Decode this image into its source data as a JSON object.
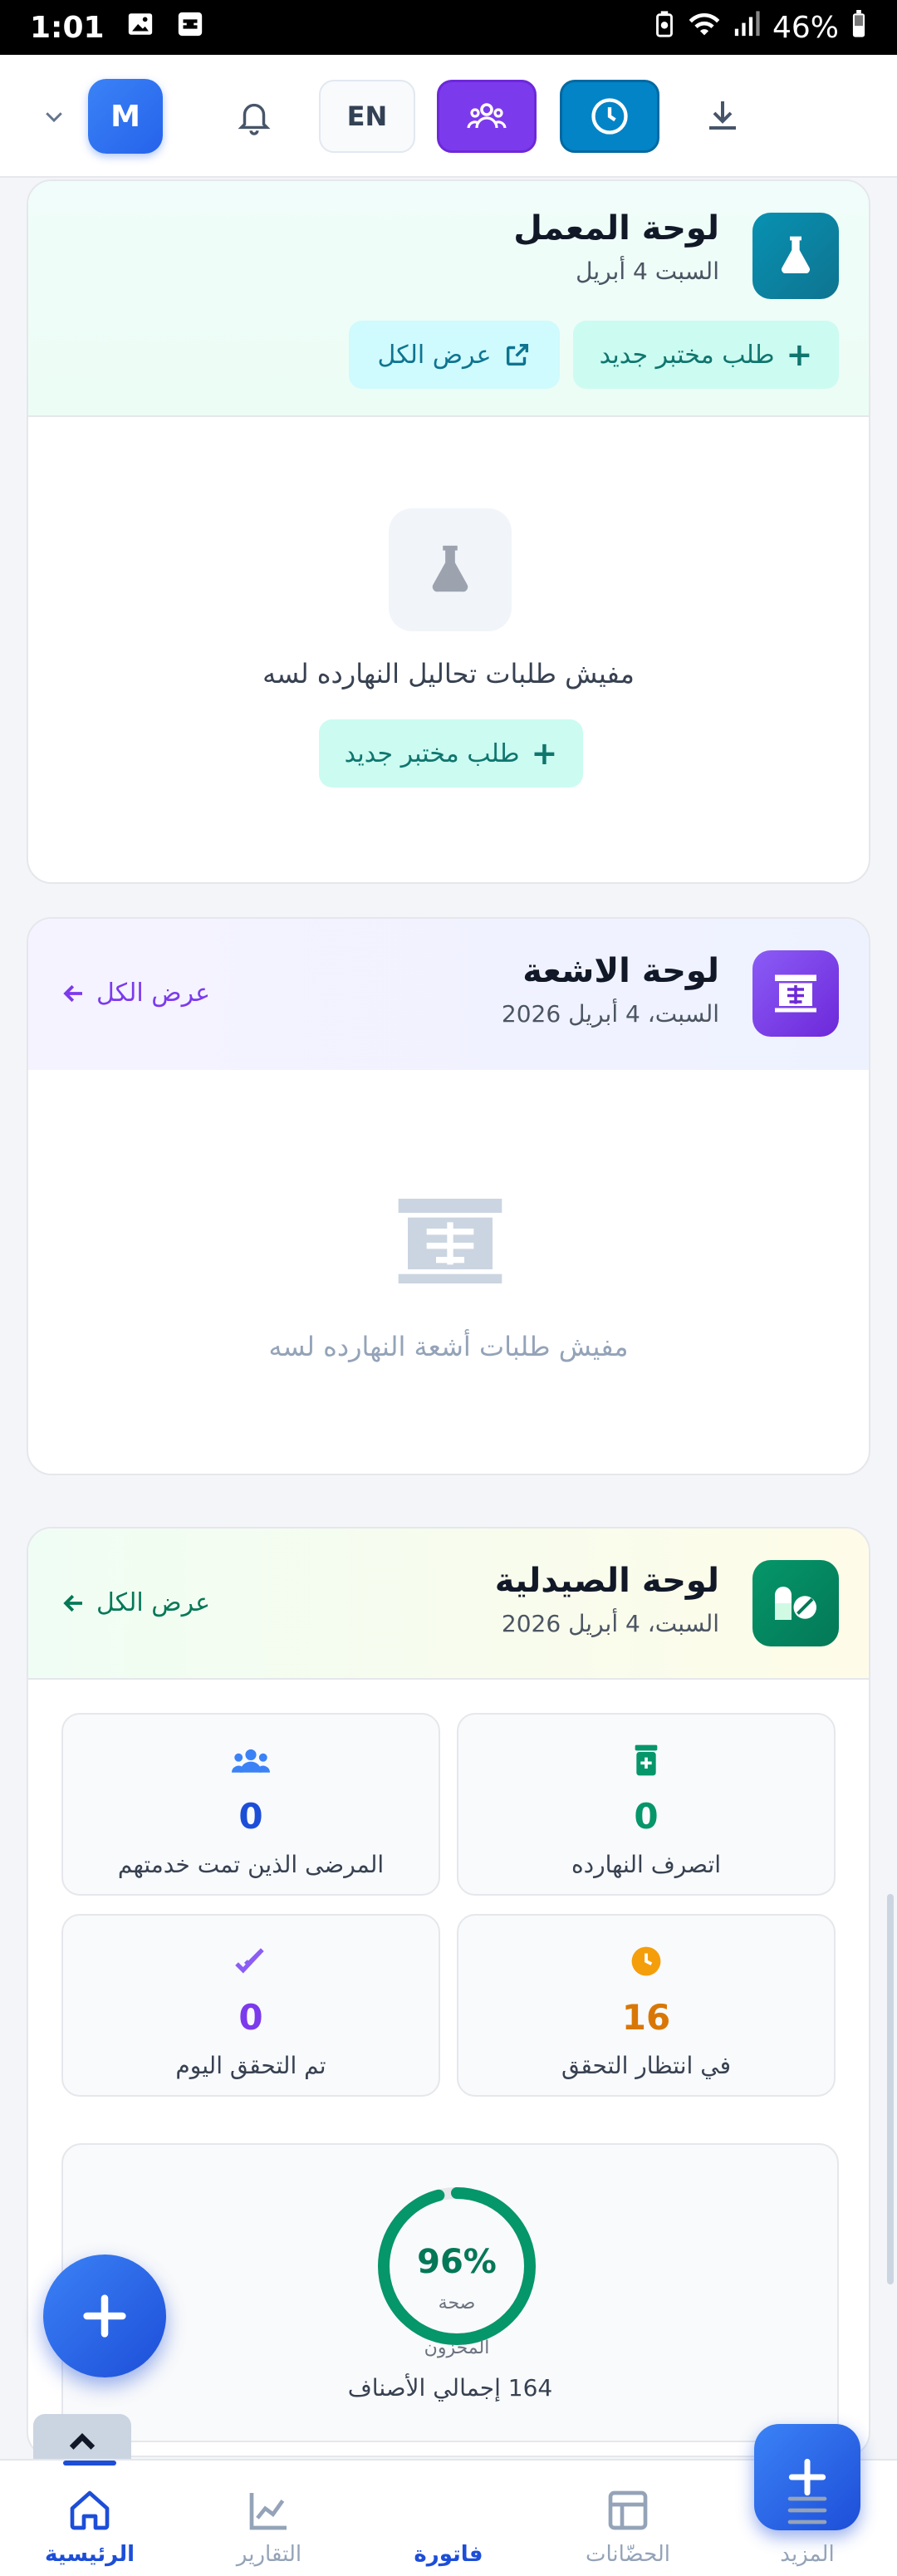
{
  "status_bar": {
    "time": "1:01",
    "battery": "46%"
  },
  "header": {
    "avatar_letter": "M",
    "language": "EN"
  },
  "lab": {
    "title": "لوحة المعمل",
    "date": "السبت 4 أبريل",
    "new_request": "طلب مختبر جديد",
    "view_all": "عرض الكل",
    "empty_text": "مفيش طلبات تحاليل النهارده لسه",
    "empty_button": "طلب مختبر جديد"
  },
  "radiology": {
    "title": "لوحة الاشعة",
    "date": "السبت، 4 أبريل 2026",
    "view_all": "عرض الكل",
    "empty_text": "مفيش طلبات أشعة النهارده لسه"
  },
  "pharmacy": {
    "title": "لوحة الصيدلية",
    "date": "السبت، 4 أبريل 2026",
    "view_all": "عرض الكل",
    "stats": {
      "dispensed": {
        "value": "0",
        "label": "اتصرف النهارده",
        "color": "#059669"
      },
      "patients": {
        "value": "0",
        "label": "المرضى الذين تمت خدمتهم",
        "color": "#1d4ed8"
      },
      "pending": {
        "value": "16",
        "label": "في انتظار التحقق",
        "color": "#d97706"
      },
      "verified": {
        "value": "0",
        "label": "تم التحقق اليوم",
        "color": "#7c3aed"
      }
    },
    "stock_health": {
      "percent": 96,
      "percent_text": "96%",
      "label_line1": "صحة",
      "label_line2": "المخزون",
      "total_items": "164 إجمالي الأصناف"
    }
  },
  "bottom_nav": {
    "home": "الرئيسية",
    "reports": "التقارير",
    "invoice": "فاتورة",
    "incubators": "الحضّانات",
    "more": "المزيد"
  }
}
